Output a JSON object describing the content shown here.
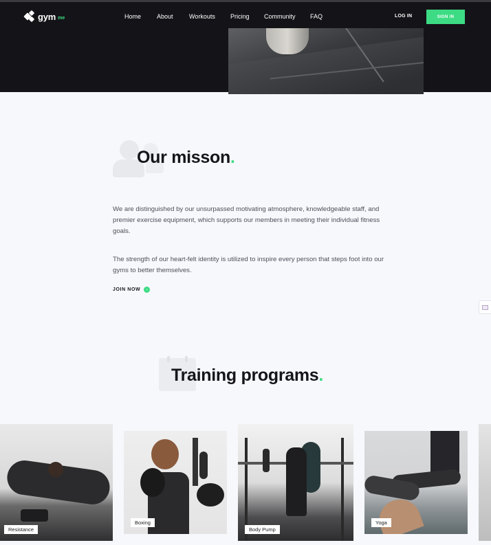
{
  "brand": {
    "name": "gym",
    "suffix": "me"
  },
  "nav": {
    "items": [
      {
        "label": "Home"
      },
      {
        "label": "About"
      },
      {
        "label": "Workouts"
      },
      {
        "label": "Pricing"
      },
      {
        "label": "Community"
      },
      {
        "label": "FAQ"
      }
    ],
    "login": "LOG IN",
    "signin": "SIGN IN"
  },
  "mission": {
    "title": "Our misson",
    "title_dot": ".",
    "paragraph1": "We are distinguished by our unsurpassed motivating atmosphere, knowledgeable staff, and premier exercise equipment, which supports our members in meeting their individual fitness goals.",
    "paragraph2": "The strength of our heart-felt identity is utilized to inspire every person that steps foot into our gyms to better themselves.",
    "cta": "JOIN NOW",
    "cta_icon": "arrow-right-icon"
  },
  "training": {
    "title": "Training programs",
    "title_dot": ".",
    "programs": [
      {
        "label": "Resistance"
      },
      {
        "label": "Boxing"
      },
      {
        "label": "Body Pump"
      },
      {
        "label": "Yoga"
      }
    ]
  },
  "colors": {
    "accent": "#3ddc84",
    "header_bg": "#141418",
    "page_bg": "#f7f8fc",
    "heading": "#15151a",
    "body_text": "#4d4f57"
  }
}
